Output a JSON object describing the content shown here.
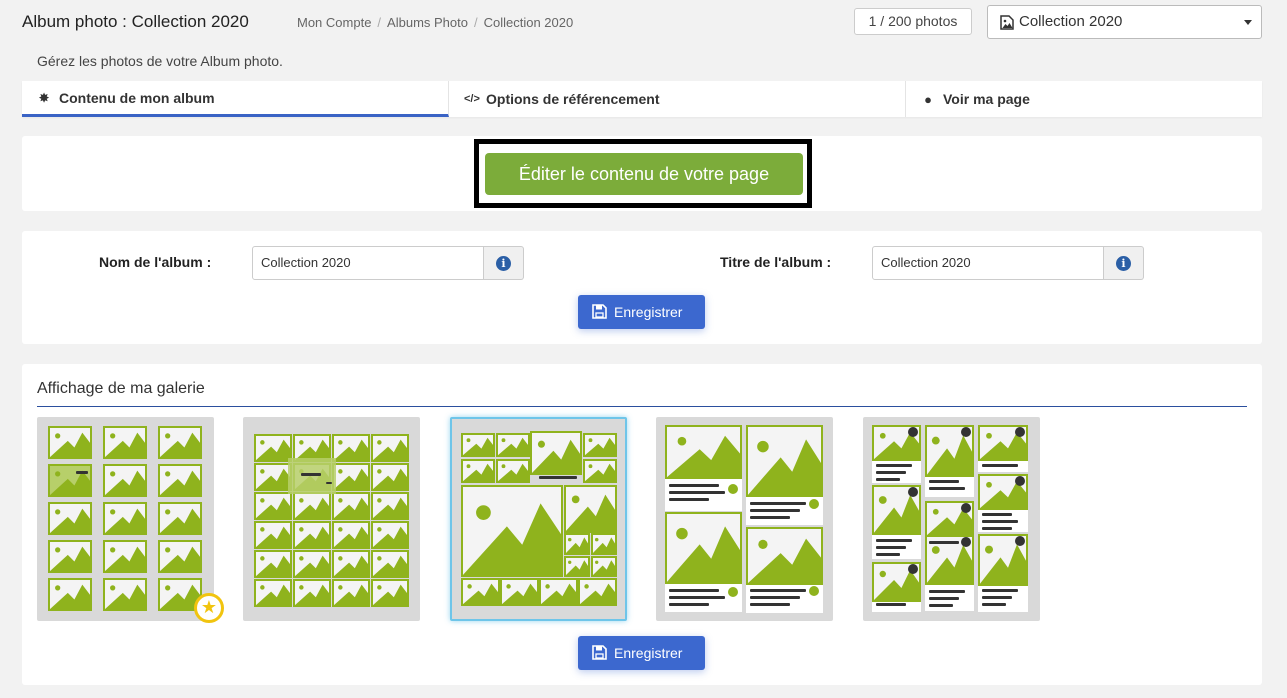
{
  "header": {
    "title": "Album photo : Collection 2020",
    "breadcrumb": [
      "Mon Compte",
      "Albums Photo",
      "Collection 2020"
    ],
    "photo_counter": "1 / 200 photos",
    "album_select": {
      "selected": "Collection 2020",
      "icon": "image-icon"
    }
  },
  "subtitle": "Gérez les photos de votre Album photo.",
  "tabs": [
    {
      "label": "Contenu de mon album",
      "icon": "gear-icon",
      "active": true
    },
    {
      "label": "Options de référencement",
      "icon": "code-icon",
      "active": false
    },
    {
      "label": "Voir ma page",
      "icon": "globe-icon",
      "active": false
    }
  ],
  "edit_button": "Éditer le contenu de votre page",
  "form": {
    "name_label": "Nom de l'album :",
    "name_value": "Collection 2020",
    "title_label": "Titre de l'album :",
    "title_value": "Collection 2020",
    "save_label": "Enregistrer"
  },
  "gallery": {
    "title": "Affichage de ma galerie",
    "layouts": [
      {
        "name": "grid-3-columns",
        "selected": false,
        "default": true
      },
      {
        "name": "grid-4-columns",
        "selected": false,
        "default": false
      },
      {
        "name": "mosaic",
        "selected": true,
        "default": false
      },
      {
        "name": "cards-2-columns",
        "selected": false,
        "default": false
      },
      {
        "name": "cards-3-columns",
        "selected": false,
        "default": false
      }
    ],
    "save_label": "Enregistrer"
  },
  "colors": {
    "accent_green": "#7cac3a",
    "image_green": "#8fb31d",
    "primary_blue": "#3c68cf",
    "tab_underline": "#3a63c5",
    "selected_border": "#6ec5e9",
    "star": "#f1c40f"
  }
}
